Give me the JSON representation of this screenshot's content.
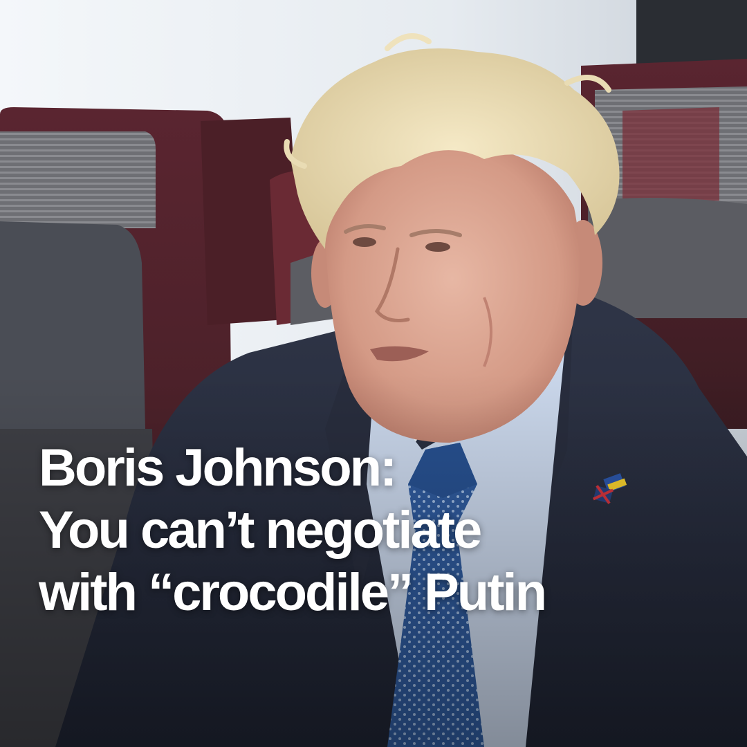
{
  "headline": {
    "lines": [
      "Boris Johnson:",
      "You can’t negotiate",
      "with “crocodile” Putin"
    ]
  }
}
